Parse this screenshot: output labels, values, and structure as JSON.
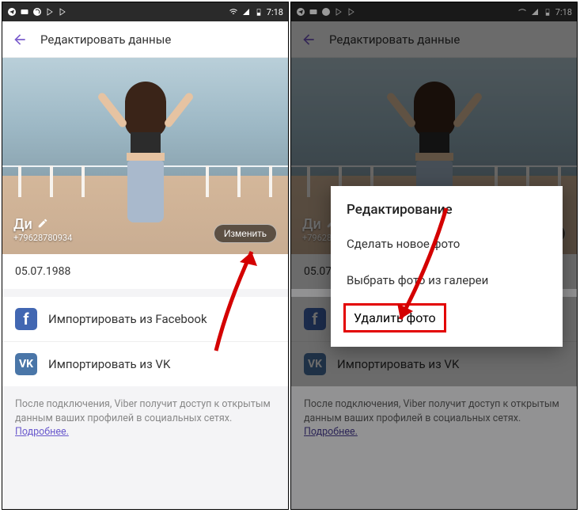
{
  "statusbar": {
    "time": "7:18"
  },
  "appbar": {
    "title": "Редактировать данные"
  },
  "profile": {
    "name": "Ди",
    "phone": "+79628780934",
    "change_label": "Изменить",
    "dob": "05.07.1988"
  },
  "import": {
    "facebook": "Импортировать из Facebook",
    "vk": "Импортировать из VK"
  },
  "footer": {
    "text": "После подключения, Viber получит доступ к открытым данным ваших профилей в социальных сетях.",
    "link": "Подробнее."
  },
  "dialog": {
    "title": "Редактирование",
    "take_photo": "Сделать новое фото",
    "choose_gallery": "Выбрать фото из галереи",
    "delete_photo": "Удалить фото"
  }
}
